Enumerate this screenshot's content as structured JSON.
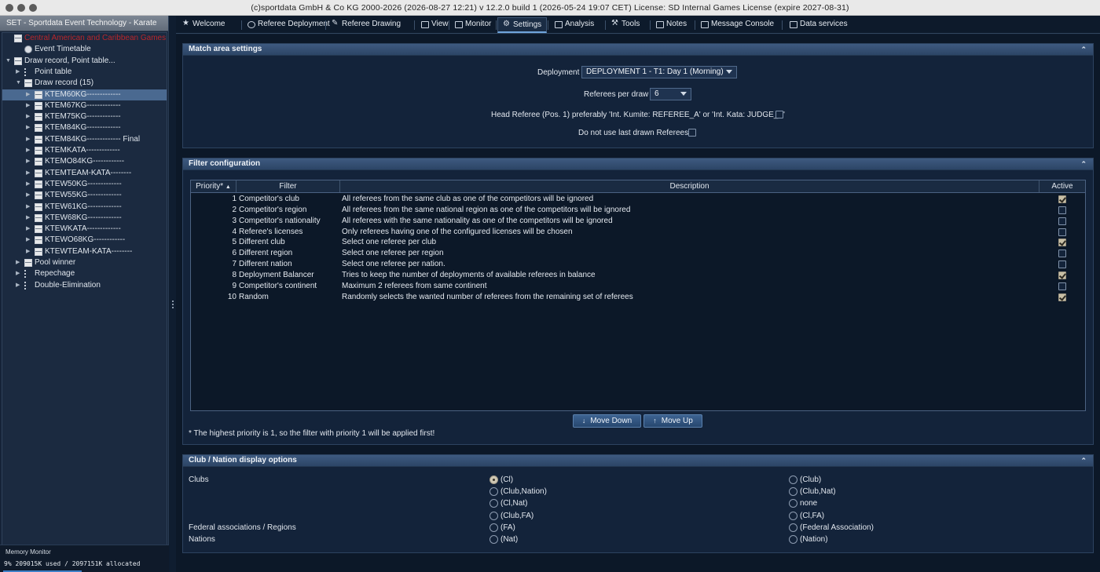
{
  "window": {
    "title": "(c)sportdata GmbH & Co KG 2000-2026 (2026-08-27 12:21)  v 12.2.0 build 1 (2026-05-24 19:07 CET) License: SD Internal Games License (expire 2027-08-31)"
  },
  "left_panel": {
    "header": "SET - Sportdata Event Technology - Karate",
    "tree": [
      {
        "label": "Central American and Caribbean Games - Ka",
        "level": 0,
        "icon": "table-icon",
        "red": true
      },
      {
        "label": "Event Timetable",
        "level": 1,
        "icon": "clock-icon"
      },
      {
        "label": "Draw record, Point table...",
        "level": 0,
        "icon": "table-icon",
        "expand": "open"
      },
      {
        "label": "Point table",
        "level": 1,
        "icon": "list-icon",
        "expand": "closed"
      },
      {
        "label": "Draw record (15)",
        "level": 1,
        "icon": "table-icon",
        "expand": "open"
      },
      {
        "label": "KTEM60KG-------------",
        "level": 2,
        "icon": "event-icon",
        "expand": "closed",
        "selected": true
      },
      {
        "label": "KTEM67KG-------------",
        "level": 2,
        "icon": "event-icon",
        "expand": "closed"
      },
      {
        "label": "KTEM75KG-------------",
        "level": 2,
        "icon": "event-icon",
        "expand": "closed"
      },
      {
        "label": "KTEM84KG-------------",
        "level": 2,
        "icon": "event-icon",
        "expand": "closed"
      },
      {
        "label": "KTEM84KG------------- Final",
        "level": 2,
        "icon": "event-icon",
        "expand": "closed"
      },
      {
        "label": "KTEMKATA-------------",
        "level": 2,
        "icon": "event-icon",
        "expand": "closed"
      },
      {
        "label": "KTEMO84KG------------",
        "level": 2,
        "icon": "event-icon",
        "expand": "closed"
      },
      {
        "label": "KTEMTEAM-KATA--------",
        "level": 2,
        "icon": "event-icon",
        "expand": "closed"
      },
      {
        "label": "KTEW50KG-------------",
        "level": 2,
        "icon": "event-icon",
        "expand": "closed"
      },
      {
        "label": "KTEW55KG-------------",
        "level": 2,
        "icon": "event-icon",
        "expand": "closed"
      },
      {
        "label": "KTEW61KG-------------",
        "level": 2,
        "icon": "event-icon",
        "expand": "closed"
      },
      {
        "label": "KTEW68KG-------------",
        "level": 2,
        "icon": "event-icon",
        "expand": "closed"
      },
      {
        "label": "KTEWKATA-------------",
        "level": 2,
        "icon": "event-icon",
        "expand": "closed"
      },
      {
        "label": "KTEWO68KG------------",
        "level": 2,
        "icon": "event-icon",
        "expand": "closed"
      },
      {
        "label": "KTEWTEAM-KATA--------",
        "level": 2,
        "icon": "event-icon",
        "expand": "closed"
      },
      {
        "label": "Pool winner",
        "level": 1,
        "icon": "table-icon",
        "expand": "closed"
      },
      {
        "label": "Repechage",
        "level": 1,
        "icon": "list-icon",
        "expand": "closed"
      },
      {
        "label": "Double-Elimination",
        "level": 1,
        "icon": "list-icon",
        "expand": "closed"
      }
    ],
    "memory": {
      "title": "Memory Monitor",
      "value": "9%  209015K used / 2097151K allocated"
    }
  },
  "tabs": [
    {
      "label": "Welcome",
      "icon": "run-icon"
    },
    {
      "label": "Referee Deployment",
      "icon": "referee-icon"
    },
    {
      "label": "Referee Drawing",
      "icon": "pen-icon"
    },
    {
      "label": "View",
      "icon": "view-icon"
    },
    {
      "label": "Monitor",
      "icon": "monitor-icon"
    },
    {
      "label": "Settings",
      "icon": "gear-icon",
      "active": true
    },
    {
      "label": "Analysis",
      "icon": "analysis-icon"
    },
    {
      "label": "Tools",
      "icon": "wrench-icon"
    },
    {
      "label": "Notes",
      "icon": "notes-icon"
    },
    {
      "label": "Message Console",
      "icon": "console-icon"
    },
    {
      "label": "Data services",
      "icon": "data-icon"
    }
  ],
  "match_area": {
    "title": "Match area settings",
    "deployment_label": "Deployment",
    "deployment_value": "DEPLOYMENT 1 - T1: Day 1 (Morning)",
    "referees_label": "Referees per draw",
    "referees_value": "6",
    "head_referee_label": "Head Referee (Pos. 1) preferably 'Int. Kumite: REFEREE_A' or 'Int. Kata: JUDGE_A'",
    "head_referee_checked": false,
    "no_last_label": "Do not use last drawn Referees",
    "no_last_checked": false
  },
  "filter_config": {
    "title": "Filter configuration",
    "columns": {
      "priority": "Priority*",
      "filter": "Filter",
      "description": "Description",
      "active": "Active"
    },
    "rows": [
      {
        "priority": "1",
        "filter": "Competitor's club",
        "description": "All referees from the same club as one of the competitors will be ignored",
        "active": true
      },
      {
        "priority": "2",
        "filter": "Competitor's region",
        "description": "All referees from the same national region as one of the competitors will be ignored",
        "active": false
      },
      {
        "priority": "3",
        "filter": "Competitor's nationality",
        "description": "All referees with the same nationality as one of the competitors will be ignored",
        "active": false
      },
      {
        "priority": "4",
        "filter": "Referee's licenses",
        "description": "Only referees having one of the configured licenses will be chosen",
        "active": false
      },
      {
        "priority": "5",
        "filter": "Different club",
        "description": "Select one referee per club",
        "active": true
      },
      {
        "priority": "6",
        "filter": "Different region",
        "description": "Select one referee per region",
        "active": false
      },
      {
        "priority": "7",
        "filter": "Different nation",
        "description": "Select one referee per nation.",
        "active": false
      },
      {
        "priority": "8",
        "filter": "Deployment Balancer",
        "description": "Tries to keep the number of deployments of available referees in balance",
        "active": true
      },
      {
        "priority": "9",
        "filter": "Competitor's continent",
        "description": "Maximum 2 referees from same continent",
        "active": false
      },
      {
        "priority": "10",
        "filter": "Random",
        "description": "Randomly selects the wanted number of referees from the remaining set of referees",
        "active": true
      }
    ],
    "move_down": "Move Down",
    "move_up": "Move Up",
    "note": "* The highest priority is 1, so the filter with priority 1 will be applied first!"
  },
  "club_nation": {
    "title": "Club / Nation display options",
    "clubs_label": "Clubs",
    "federal_label": "Federal associations / Regions",
    "nations_label": "Nations",
    "clubs_col1": [
      "(Cl)",
      "(Club,Nation)",
      "(Cl,Nat)",
      "(Club,FA)"
    ],
    "clubs_col2": [
      "(Club)",
      "(Club,Nat)",
      "none",
      "(Cl,FA)"
    ],
    "clubs_selected": "(Cl)",
    "federal_options": [
      "(FA)",
      "(Federal Association)"
    ],
    "nations_options": [
      "(Nat)",
      "(Nation)"
    ]
  }
}
